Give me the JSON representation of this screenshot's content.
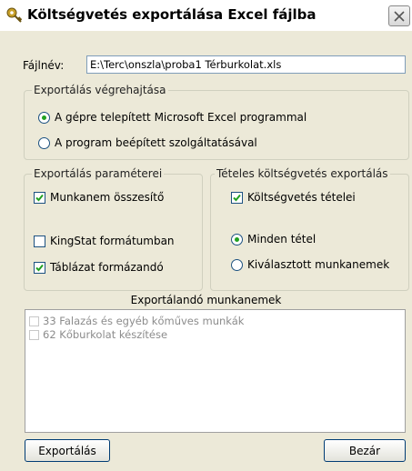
{
  "window": {
    "title": "Költségvetés exportálása Excel fájlba",
    "title_icon": "key-icon",
    "close_icon": "close-icon"
  },
  "file": {
    "label": "Fájlnév:",
    "value": "E:\\Terc\\onszla\\proba1 Térburkolat.xls"
  },
  "export_execution": {
    "legend": "Exportálás végrehajtása",
    "options": [
      {
        "label": "A gépre telepített Microsoft Excel programmal",
        "selected": true
      },
      {
        "label": "A program beépített szolgáltatásával",
        "selected": false
      }
    ]
  },
  "export_params": {
    "legend": "Exportálás paraméterei",
    "options": [
      {
        "label": "Munkanem összesítő",
        "checked": true
      },
      {
        "label": "KingStat formátumban",
        "checked": false
      },
      {
        "label": "Táblázat formázandó",
        "checked": true
      }
    ]
  },
  "itemized_export": {
    "legend": "Tételes költségvetés exportálás",
    "checkbox": {
      "label": "Költségvetés tételei",
      "checked": true
    },
    "options": [
      {
        "label": "Minden tétel",
        "selected": true
      },
      {
        "label": "Kiválasztott munkanemek",
        "selected": false
      }
    ]
  },
  "work_types": {
    "title": "Exportálandó munkanemek",
    "items": [
      {
        "label": "33 Falazás és egyéb kőműves munkák",
        "checked": false
      },
      {
        "label": "62 Kőburkolat készítése",
        "checked": false
      }
    ]
  },
  "buttons": {
    "export": "Exportálás",
    "close": "Bezár"
  },
  "colors": {
    "window_bg": "#ece9d8",
    "radio_dot": "#21a121",
    "check_mark": "#21a121"
  }
}
